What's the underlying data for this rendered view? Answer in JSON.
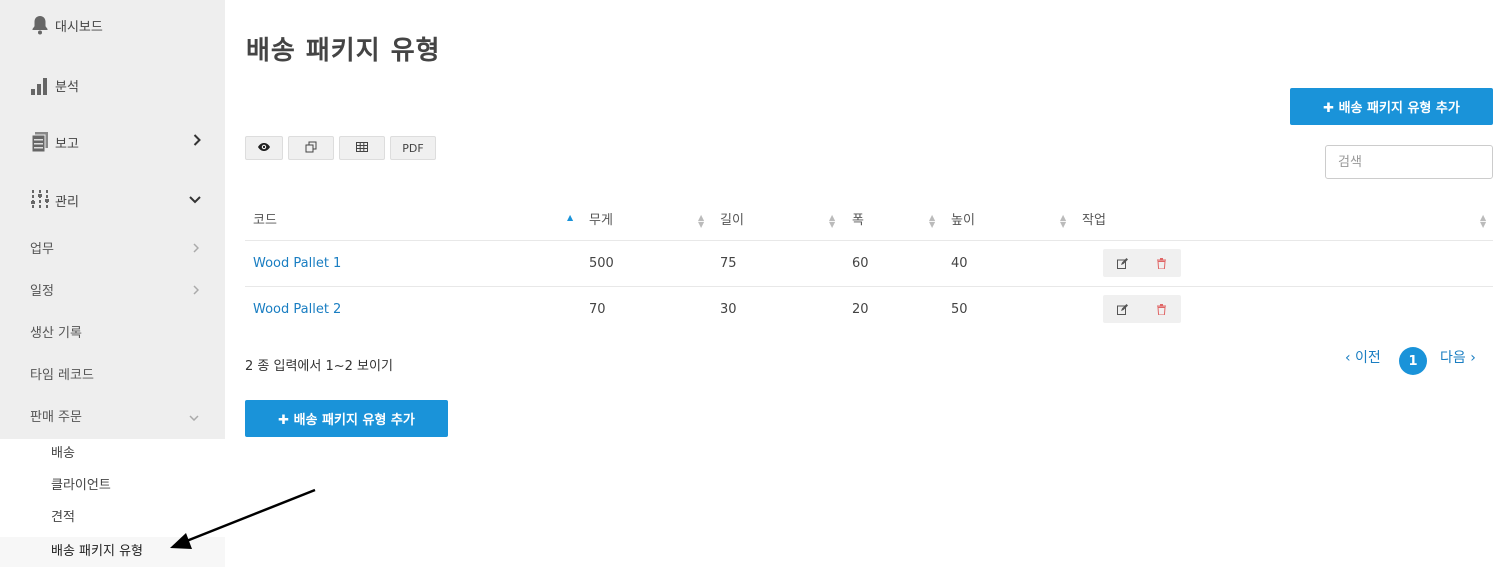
{
  "sidebar": {
    "items": [
      {
        "label": "대시보드",
        "icon": "bell-icon"
      },
      {
        "label": "분석",
        "icon": "bar-chart-icon"
      },
      {
        "label": "보고",
        "icon": "report-icon",
        "chevron": "›"
      },
      {
        "label": "관리",
        "icon": "sliders-icon",
        "chevron": "⌄"
      }
    ],
    "sub_items": [
      {
        "label": "업무",
        "chevron": "›"
      },
      {
        "label": "일정",
        "chevron": "›"
      },
      {
        "label": "생산 기록"
      },
      {
        "label": "타임 레코드"
      },
      {
        "label": "판매 주문",
        "chevron": "⌄"
      }
    ],
    "sales_sub_items": [
      {
        "label": "배송"
      },
      {
        "label": "클라이언트"
      },
      {
        "label": "견적"
      },
      {
        "label": "배송 패키지 유형",
        "active": true
      }
    ]
  },
  "main": {
    "title": "배송 패키지 유형",
    "add_button_label": "✚ 배송 패키지 유형 추가",
    "toolbar": {
      "view_icon": "eye-icon",
      "copy_icon": "copy-icon",
      "csv_icon": "table-icon",
      "pdf_label": "PDF"
    },
    "search_placeholder": "검색",
    "table": {
      "columns": [
        "코드",
        "무게",
        "길이",
        "폭",
        "높이",
        "작업"
      ],
      "rows": [
        {
          "code": "Wood Pallet 1",
          "weight": "500",
          "length": "75",
          "width": "60",
          "height": "40"
        },
        {
          "code": "Wood Pallet 2",
          "weight": "70",
          "length": "30",
          "width": "20",
          "height": "50"
        }
      ]
    },
    "info_text": "2 종 입력에서 1~2 보이기",
    "pagination": {
      "prev": "‹ 이전",
      "current": "1",
      "next": "다음 ›"
    }
  },
  "colors": {
    "primary": "#1a93d9",
    "link": "#1a7ec2",
    "delete": "#e06666",
    "sidebar_bg": "#eeeeee"
  }
}
